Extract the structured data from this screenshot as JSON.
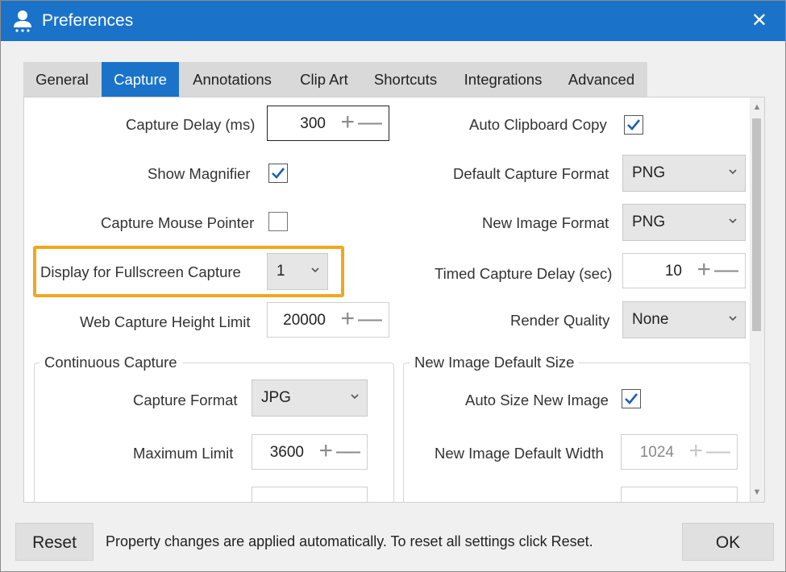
{
  "window": {
    "title": "Preferences",
    "close_glyph": "✕",
    "app_icon": "user-icon",
    "accent": "#1a73c8"
  },
  "tabs": [
    {
      "label": "General",
      "active": false
    },
    {
      "label": "Capture",
      "active": true
    },
    {
      "label": "Annotations",
      "active": false
    },
    {
      "label": "Clip Art",
      "active": false
    },
    {
      "label": "Shortcuts",
      "active": false
    },
    {
      "label": "Integrations",
      "active": false
    },
    {
      "label": "Advanced",
      "active": false
    }
  ],
  "left": {
    "capture_delay": {
      "label": "Capture Delay (ms)",
      "value": "300"
    },
    "show_magnifier": {
      "label": "Show Magnifier",
      "checked": true
    },
    "capture_mouse_pointer": {
      "label": "Capture Mouse Pointer",
      "checked": false
    },
    "display_fullscreen": {
      "label": "Display for Fullscreen Capture",
      "value": "1"
    },
    "web_capture_height": {
      "label": "Web Capture Height Limit",
      "value": "20000"
    }
  },
  "right": {
    "auto_clipboard": {
      "label": "Auto Clipboard Copy",
      "checked": true
    },
    "default_capture_format": {
      "label": "Default Capture Format",
      "value": "PNG"
    },
    "new_image_format": {
      "label": "New Image Format",
      "value": "PNG"
    },
    "timed_capture_delay": {
      "label": "Timed Capture Delay (sec)",
      "value": "10"
    },
    "render_quality": {
      "label": "Render Quality",
      "value": "None"
    }
  },
  "continuous": {
    "title": "Continuous Capture",
    "capture_format": {
      "label": "Capture Format",
      "value": "JPG"
    },
    "maximum_limit": {
      "label": "Maximum Limit",
      "value": "3600"
    }
  },
  "new_image_size": {
    "title": "New Image Default Size",
    "auto_size": {
      "label": "Auto Size New Image",
      "checked": true
    },
    "default_width": {
      "label": "New Image Default Width",
      "value": "1024"
    }
  },
  "spin_glyphs": {
    "plus": "+",
    "minus": "—"
  },
  "footer": {
    "reset_label": "Reset",
    "message": "Property changes are applied automatically. To reset all settings click Reset.",
    "ok_label": "OK"
  },
  "highlight_color": "#f0a81c"
}
